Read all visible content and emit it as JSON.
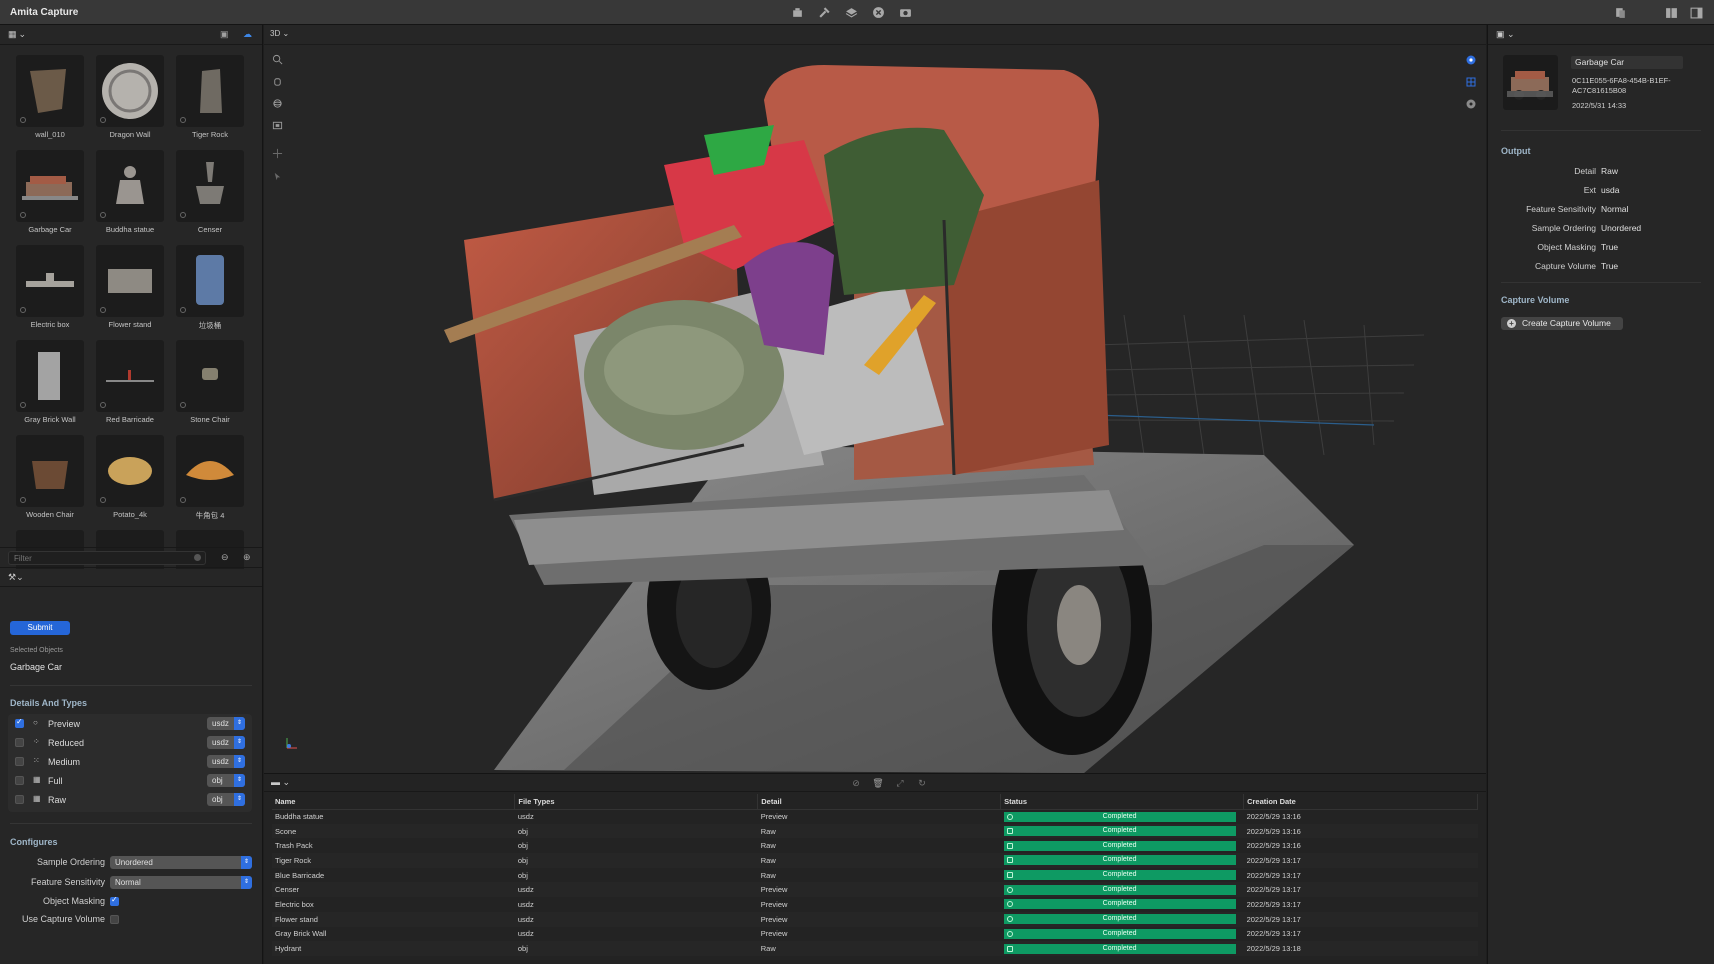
{
  "app": {
    "title": "Amita Capture"
  },
  "library": {
    "items": [
      {
        "name": "wall_010",
        "color": "#6b5a48",
        "shape": "frag"
      },
      {
        "name": "Dragon Wall",
        "color": "#b5b2ad",
        "shape": "disc"
      },
      {
        "name": "Tiger Rock",
        "color": "#6f6a62",
        "shape": "rock"
      },
      {
        "name": "Garbage Car",
        "color": "#8c6a58",
        "shape": "car"
      },
      {
        "name": "Buddha statue",
        "color": "#9a9590",
        "shape": "statue"
      },
      {
        "name": "Censer",
        "color": "#7d7a75",
        "shape": "censer"
      },
      {
        "name": "Electric box",
        "color": "#a5a29c",
        "shape": "flat"
      },
      {
        "name": "Flower stand",
        "color": "#8e8a83",
        "shape": "box"
      },
      {
        "name": "垃圾桶",
        "color": "#5d7aa6",
        "shape": "bin"
      },
      {
        "name": "Gray Brick Wall",
        "color": "#a3a3a3",
        "shape": "tall"
      },
      {
        "name": "Red Barricade",
        "color": "#b03a2e",
        "shape": "thin"
      },
      {
        "name": "Stone Chair",
        "color": "#85806f",
        "shape": "small"
      },
      {
        "name": "Wooden Chair",
        "color": "#6b4a34",
        "shape": "chair"
      },
      {
        "name": "Potato_4k",
        "color": "#c9a25a",
        "shape": "potato"
      },
      {
        "name": "牛角包 4",
        "color": "#d08a3a",
        "shape": "croissant"
      }
    ],
    "filter_placeholder": "Filter"
  },
  "request": {
    "submit_label": "Submit",
    "selected_objects_label": "Selected Objects",
    "selected_object": "Garbage Car",
    "details_title": "Details And Types",
    "details": [
      {
        "name": "Preview",
        "ext": "usdz",
        "checked": true,
        "icon": "○"
      },
      {
        "name": "Reduced",
        "ext": "usdz",
        "checked": false,
        "icon": "⁘"
      },
      {
        "name": "Medium",
        "ext": "usdz",
        "checked": false,
        "icon": "⁙"
      },
      {
        "name": "Full",
        "ext": "obj",
        "checked": false,
        "icon": "▦"
      },
      {
        "name": "Raw",
        "ext": "obj",
        "checked": false,
        "icon": "▦"
      }
    ],
    "configures_title": "Configures",
    "sample_ordering_label": "Sample Ordering",
    "sample_ordering_value": "Unordered",
    "feature_sensitivity_label": "Feature Sensitivity",
    "feature_sensitivity_value": "Normal",
    "object_masking_label": "Object Masking",
    "object_masking": true,
    "use_capture_volume_label": "Use Capture Volume",
    "use_capture_volume": false
  },
  "viewport": {
    "mode": "3D"
  },
  "queue": {
    "columns": [
      "Name",
      "File Types",
      "Detail",
      "Status",
      "Creation Date"
    ],
    "rows": [
      [
        "Buddha statue",
        "usdz",
        "Preview",
        "Completed",
        "2022/5/29 13:16"
      ],
      [
        "Scone",
        "obj",
        "Raw",
        "Completed",
        "2022/5/29 13:16"
      ],
      [
        "Trash Pack",
        "obj",
        "Raw",
        "Completed",
        "2022/5/29 13:16"
      ],
      [
        "Tiger Rock",
        "obj",
        "Raw",
        "Completed",
        "2022/5/29 13:17"
      ],
      [
        "Blue Barricade",
        "obj",
        "Raw",
        "Completed",
        "2022/5/29 13:17"
      ],
      [
        "Censer",
        "usdz",
        "Preview",
        "Completed",
        "2022/5/29 13:17"
      ],
      [
        "Electric box",
        "usdz",
        "Preview",
        "Completed",
        "2022/5/29 13:17"
      ],
      [
        "Flower stand",
        "usdz",
        "Preview",
        "Completed",
        "2022/5/29 13:17"
      ],
      [
        "Gray Brick Wall",
        "usdz",
        "Preview",
        "Completed",
        "2022/5/29 13:17"
      ],
      [
        "Hydrant",
        "obj",
        "Raw",
        "Completed",
        "2022/5/29 13:18"
      ]
    ]
  },
  "inspector": {
    "name": "Garbage Car",
    "id": "0C11E055-6FA8-454B-B1EF-AC7C81615B08",
    "date": "2022/5/31 14:33",
    "output_title": "Output",
    "output": [
      {
        "key": "Detail",
        "value": "Raw"
      },
      {
        "key": "Ext",
        "value": "usda"
      },
      {
        "key": "Feature Sensitivity",
        "value": "Normal"
      },
      {
        "key": "Sample Ordering",
        "value": "Unordered"
      },
      {
        "key": "Object Masking",
        "value": "True"
      },
      {
        "key": "Capture Volume",
        "value": "True"
      }
    ],
    "capture_volume_title": "Capture Volume",
    "create_capture_volume_label": "Create Capture Volume"
  },
  "colors": {
    "accent": "#2f6fe0",
    "status_completed": "#0e9a63"
  }
}
